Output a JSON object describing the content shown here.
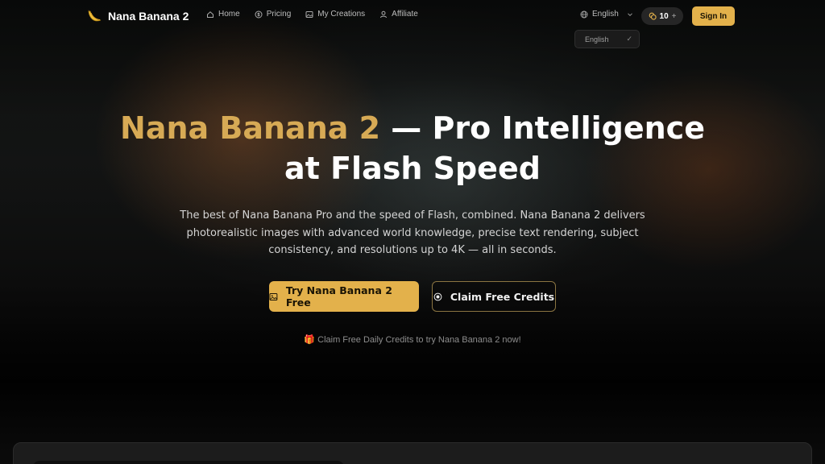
{
  "brand": {
    "name": "Nana Banana 2",
    "logo_icon": "banana-icon"
  },
  "nav": {
    "items": [
      {
        "label": "Home",
        "icon": "home-icon"
      },
      {
        "label": "Pricing",
        "icon": "dollar-circle-icon"
      },
      {
        "label": "My Creations",
        "icon": "gallery-icon"
      },
      {
        "label": "Affiliate",
        "icon": "user-icon"
      }
    ],
    "language": "English",
    "credits": "10",
    "credits_plus": "+",
    "sign_in": "Sign In"
  },
  "language_menu": {
    "option": "English",
    "selected": true
  },
  "hero": {
    "title_accent": "Nana Banana 2",
    "title_rest": " — Pro Intelligence",
    "title_line2": "at Flash Speed",
    "subtitle": "The best of Nana Banana Pro and the speed of Flash, combined. Nana Banana 2 delivers photorealistic images with advanced world knowledge, precise text rendering, subject consistency, and resolutions up to 4K — all in seconds.",
    "primary_button": "Try Nana Banana 2 Free",
    "secondary_button": "Claim Free Credits",
    "hint": "🎁 Claim Free Daily Credits to try Nana Banana 2 now!"
  },
  "colors": {
    "accent": "#e3b14b",
    "title_accent": "#d7aa55",
    "background": "#0b0b0b"
  }
}
